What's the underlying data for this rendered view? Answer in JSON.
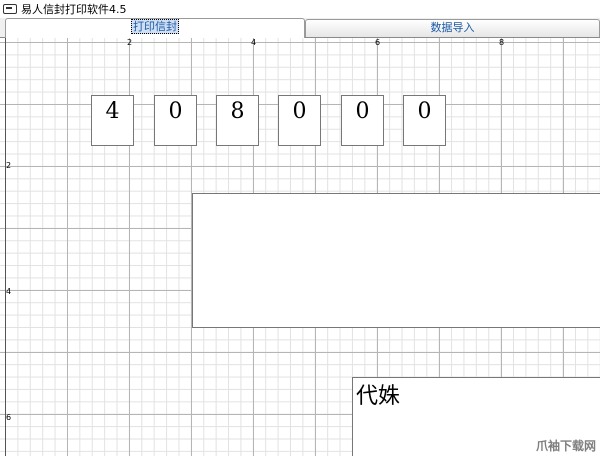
{
  "window": {
    "title": "易人信封打印软件4.5",
    "icon": "envelope-app-icon"
  },
  "tabs": [
    {
      "label": "打印信封",
      "active": true
    },
    {
      "label": "数据导入",
      "active": false
    }
  ],
  "ruler": {
    "x_labels": [
      "2",
      "4",
      "6",
      "8"
    ],
    "y_labels": [
      "2",
      "4",
      "6"
    ]
  },
  "envelope": {
    "postcode_digits": [
      "4",
      "0",
      "8",
      "0",
      "0",
      "0"
    ],
    "recipient_address": "",
    "sender_text": "代姝"
  },
  "watermark": "爪袖下载网"
}
